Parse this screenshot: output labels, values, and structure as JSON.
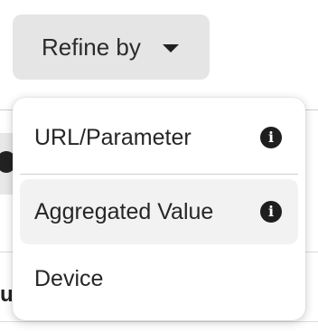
{
  "refine": {
    "label": "Refine by",
    "icon": "caret-down-icon"
  },
  "dropdown": {
    "items": [
      {
        "label": "URL/Parameter",
        "icon": "info-icon",
        "highlighted": false
      },
      {
        "label": "Aggregated Value",
        "icon": "info-icon",
        "highlighted": true
      },
      {
        "label": "Device",
        "icon": null,
        "highlighted": false
      }
    ],
    "info_glyph": "i"
  },
  "background": {
    "partial_letter": "u"
  },
  "colors": {
    "button_bg": "#e5e5e5",
    "highlight_bg": "#f2f2f2",
    "text": "#262626",
    "icon": "#1e1e1e"
  }
}
